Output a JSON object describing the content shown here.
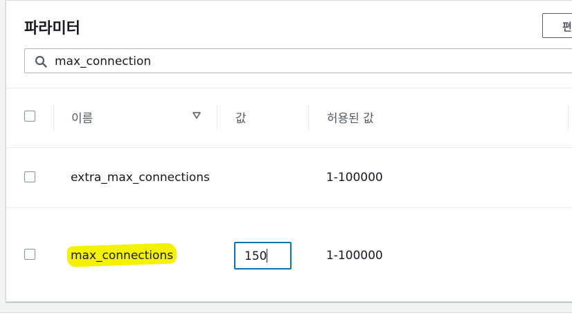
{
  "panel": {
    "title": "파라미터",
    "edit_button_label": "편"
  },
  "search": {
    "value": "max_connection",
    "icon": "search-icon"
  },
  "table": {
    "columns": [
      {
        "label": "이름",
        "sortable": true
      },
      {
        "label": "값"
      },
      {
        "label": "허용된 값"
      }
    ],
    "rows": [
      {
        "name": "extra_max_connections",
        "value": "",
        "allowed": "1-100000",
        "checked": false
      },
      {
        "name": "max_connections",
        "value": "150",
        "allowed": "1-100000",
        "checked": false,
        "highlighted": true,
        "editing": true
      }
    ]
  },
  "colors": {
    "highlight": "#f5f200",
    "focus_border": "#0073bb"
  }
}
